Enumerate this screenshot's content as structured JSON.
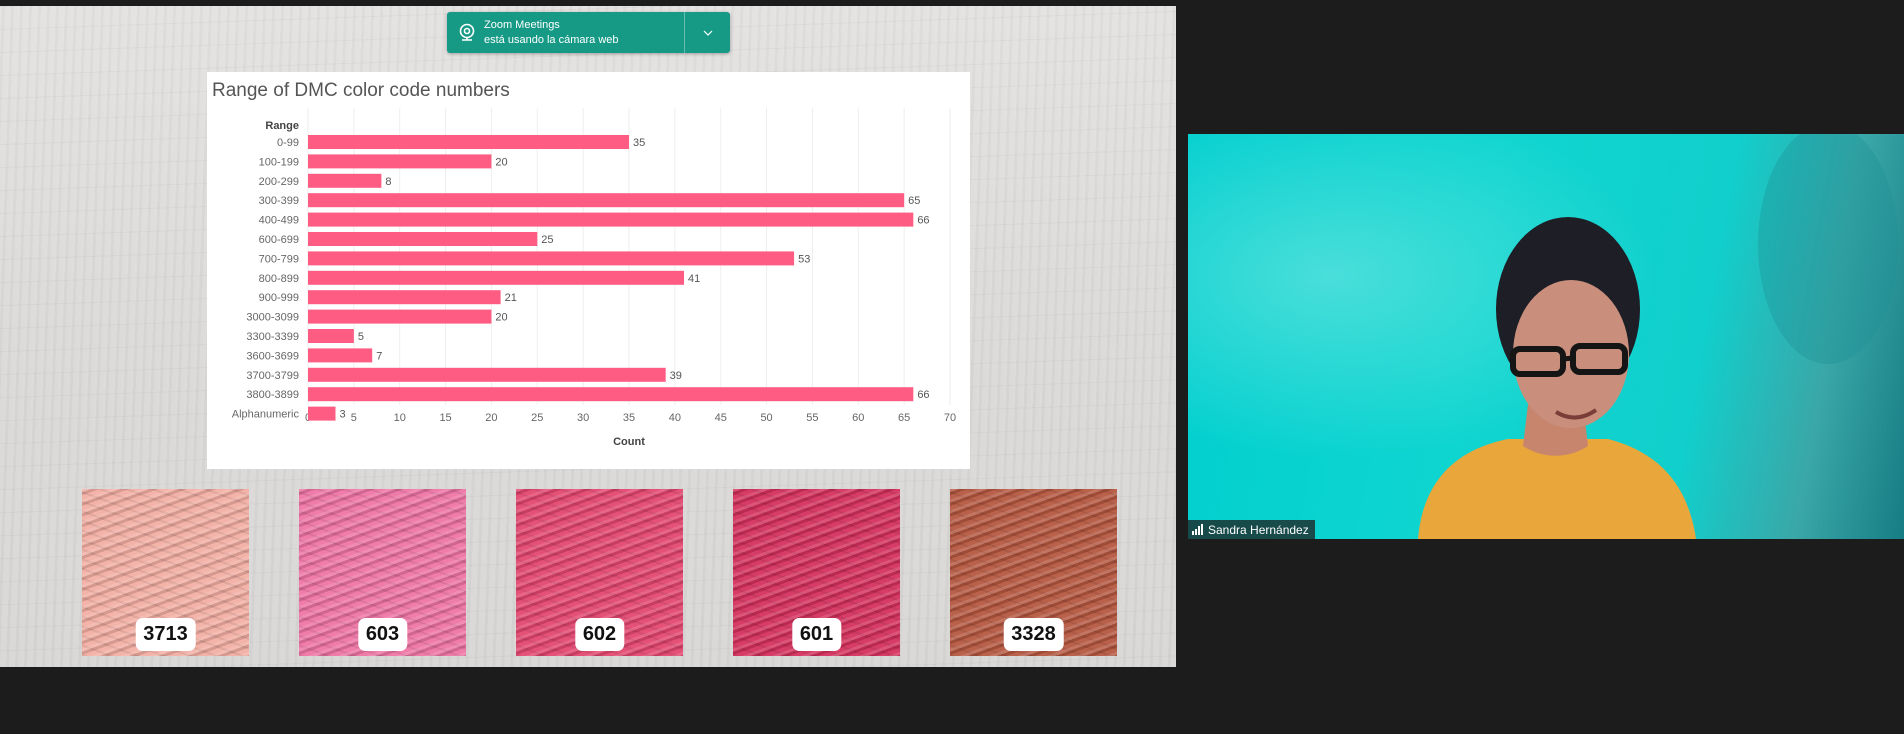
{
  "notification": {
    "app": "Zoom Meetings",
    "message": "está usando la cámara web"
  },
  "chart_data": {
    "type": "bar",
    "orientation": "horizontal",
    "title": "Range of DMC color code numbers",
    "category_label": "Range",
    "xlabel": "Count",
    "categories": [
      "0-99",
      "100-199",
      "200-299",
      "300-399",
      "400-499",
      "600-699",
      "700-799",
      "800-899",
      "900-999",
      "3000-3099",
      "3300-3399",
      "3600-3699",
      "3700-3799",
      "3800-3899",
      "Alphanumeric"
    ],
    "values": [
      35,
      20,
      8,
      65,
      66,
      25,
      53,
      41,
      21,
      20,
      5,
      7,
      39,
      66,
      3
    ],
    "xlim": [
      0,
      70
    ],
    "xticks": [
      0,
      5,
      10,
      15,
      20,
      25,
      30,
      35,
      40,
      45,
      50,
      55,
      60,
      65,
      70
    ],
    "grid": true,
    "bar_color": "#ff5c84"
  },
  "skeins": [
    {
      "code": "3713",
      "color": "#f2aea3"
    },
    {
      "code": "603",
      "color": "#ee74a4"
    },
    {
      "code": "602",
      "color": "#e3466f"
    },
    {
      "code": "601",
      "color": "#d4305c"
    },
    {
      "code": "3328",
      "color": "#b5573f"
    }
  ],
  "participant": {
    "name": "Sandra Hernández",
    "shirt_color": "#e9a63b",
    "background_color": "#00d0cf"
  }
}
